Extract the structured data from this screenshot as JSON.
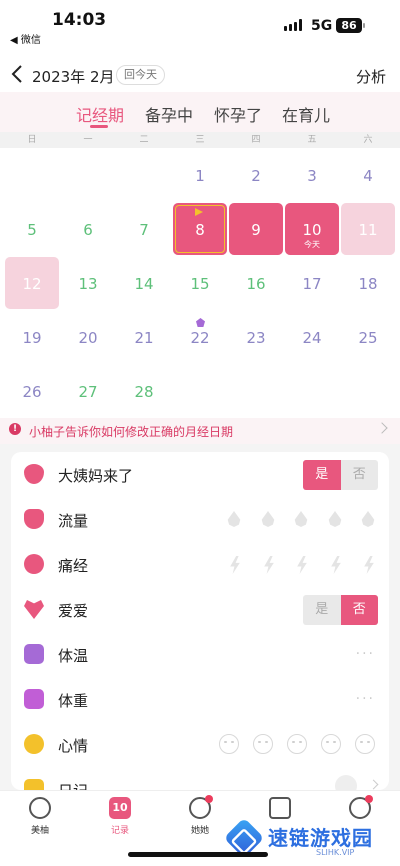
{
  "status_bar": {
    "time": "14:03",
    "back_app": "◀ 微信",
    "network": "5G",
    "battery": "86"
  },
  "nav": {
    "title": "2023年 2月",
    "today_button": "回今天",
    "analyze": "分析"
  },
  "tabs": [
    {
      "label": "记经期",
      "active": true
    },
    {
      "label": "备孕中",
      "active": false
    },
    {
      "label": "怀孕了",
      "active": false
    },
    {
      "label": "在育儿",
      "active": false
    }
  ],
  "weekdays": [
    "日",
    "一",
    "二",
    "三",
    "四",
    "五",
    "六"
  ],
  "calendar": {
    "today_label": "今天",
    "weeks": [
      [
        null,
        null,
        null,
        {
          "d": "1",
          "s": "purple"
        },
        {
          "d": "2",
          "s": "purple"
        },
        {
          "d": "3",
          "s": "purple"
        },
        {
          "d": "4",
          "s": "purple"
        }
      ],
      [
        {
          "d": "5",
          "s": "green"
        },
        {
          "d": "6",
          "s": "green"
        },
        {
          "d": "7",
          "s": "green"
        },
        {
          "d": "8",
          "s": "period",
          "flag": true,
          "selected": true
        },
        {
          "d": "9",
          "s": "period"
        },
        {
          "d": "10",
          "s": "period",
          "today": true
        },
        {
          "d": "11",
          "s": "predicted"
        }
      ],
      [
        {
          "d": "12",
          "s": "predicted"
        },
        {
          "d": "13",
          "s": "green"
        },
        {
          "d": "14",
          "s": "green"
        },
        {
          "d": "15",
          "s": "green"
        },
        {
          "d": "16",
          "s": "green"
        },
        {
          "d": "17",
          "s": "purple"
        },
        {
          "d": "18",
          "s": "purple"
        }
      ],
      [
        {
          "d": "19",
          "s": "purple"
        },
        {
          "d": "20",
          "s": "purple"
        },
        {
          "d": "21",
          "s": "purple"
        },
        {
          "d": "22",
          "s": "purple",
          "ovulation": true
        },
        {
          "d": "23",
          "s": "purple"
        },
        {
          "d": "24",
          "s": "purple"
        },
        {
          "d": "25",
          "s": "purple"
        }
      ],
      [
        {
          "d": "26",
          "s": "purple"
        },
        {
          "d": "27",
          "s": "green"
        },
        {
          "d": "28",
          "s": "green"
        },
        null,
        null,
        null,
        null
      ]
    ]
  },
  "tip": {
    "text": "小柚子告诉你如何修改正确的月经日期"
  },
  "records": {
    "period": {
      "label": "大姨妈来了",
      "yes": "是",
      "no": "否",
      "value": "yes",
      "icon_color": "#e8577e"
    },
    "flow": {
      "label": "流量",
      "icon_color": "#e8577e"
    },
    "cramps": {
      "label": "痛经",
      "icon_color": "#e8577e"
    },
    "love": {
      "label": "爱爱",
      "yes": "是",
      "no": "否",
      "value": "no",
      "icon_color": "#e8577e"
    },
    "temperature": {
      "label": "体温",
      "more": "···",
      "icon_color": "#a56ad6"
    },
    "weight": {
      "label": "体重",
      "more": "···",
      "icon_color": "#c15ed6"
    },
    "mood": {
      "label": "心情",
      "icon_color": "#f3c12b"
    },
    "diary": {
      "label": "日记",
      "icon_color": "#f3c12b"
    }
  },
  "bottom_tabs": [
    {
      "label": "美柚",
      "icon": "meiyou-icon"
    },
    {
      "label": "记录",
      "icon": "calendar-10-icon",
      "icon_text": "10",
      "active": true
    },
    {
      "label": "她她",
      "icon": "swirl-icon",
      "badge": true
    },
    {
      "label": "",
      "icon": "bag-icon"
    },
    {
      "label": "",
      "icon": "profile-icon",
      "badge": true
    }
  ],
  "watermark": {
    "text": "速链游戏园",
    "sub": "SLIHK.VIP"
  }
}
